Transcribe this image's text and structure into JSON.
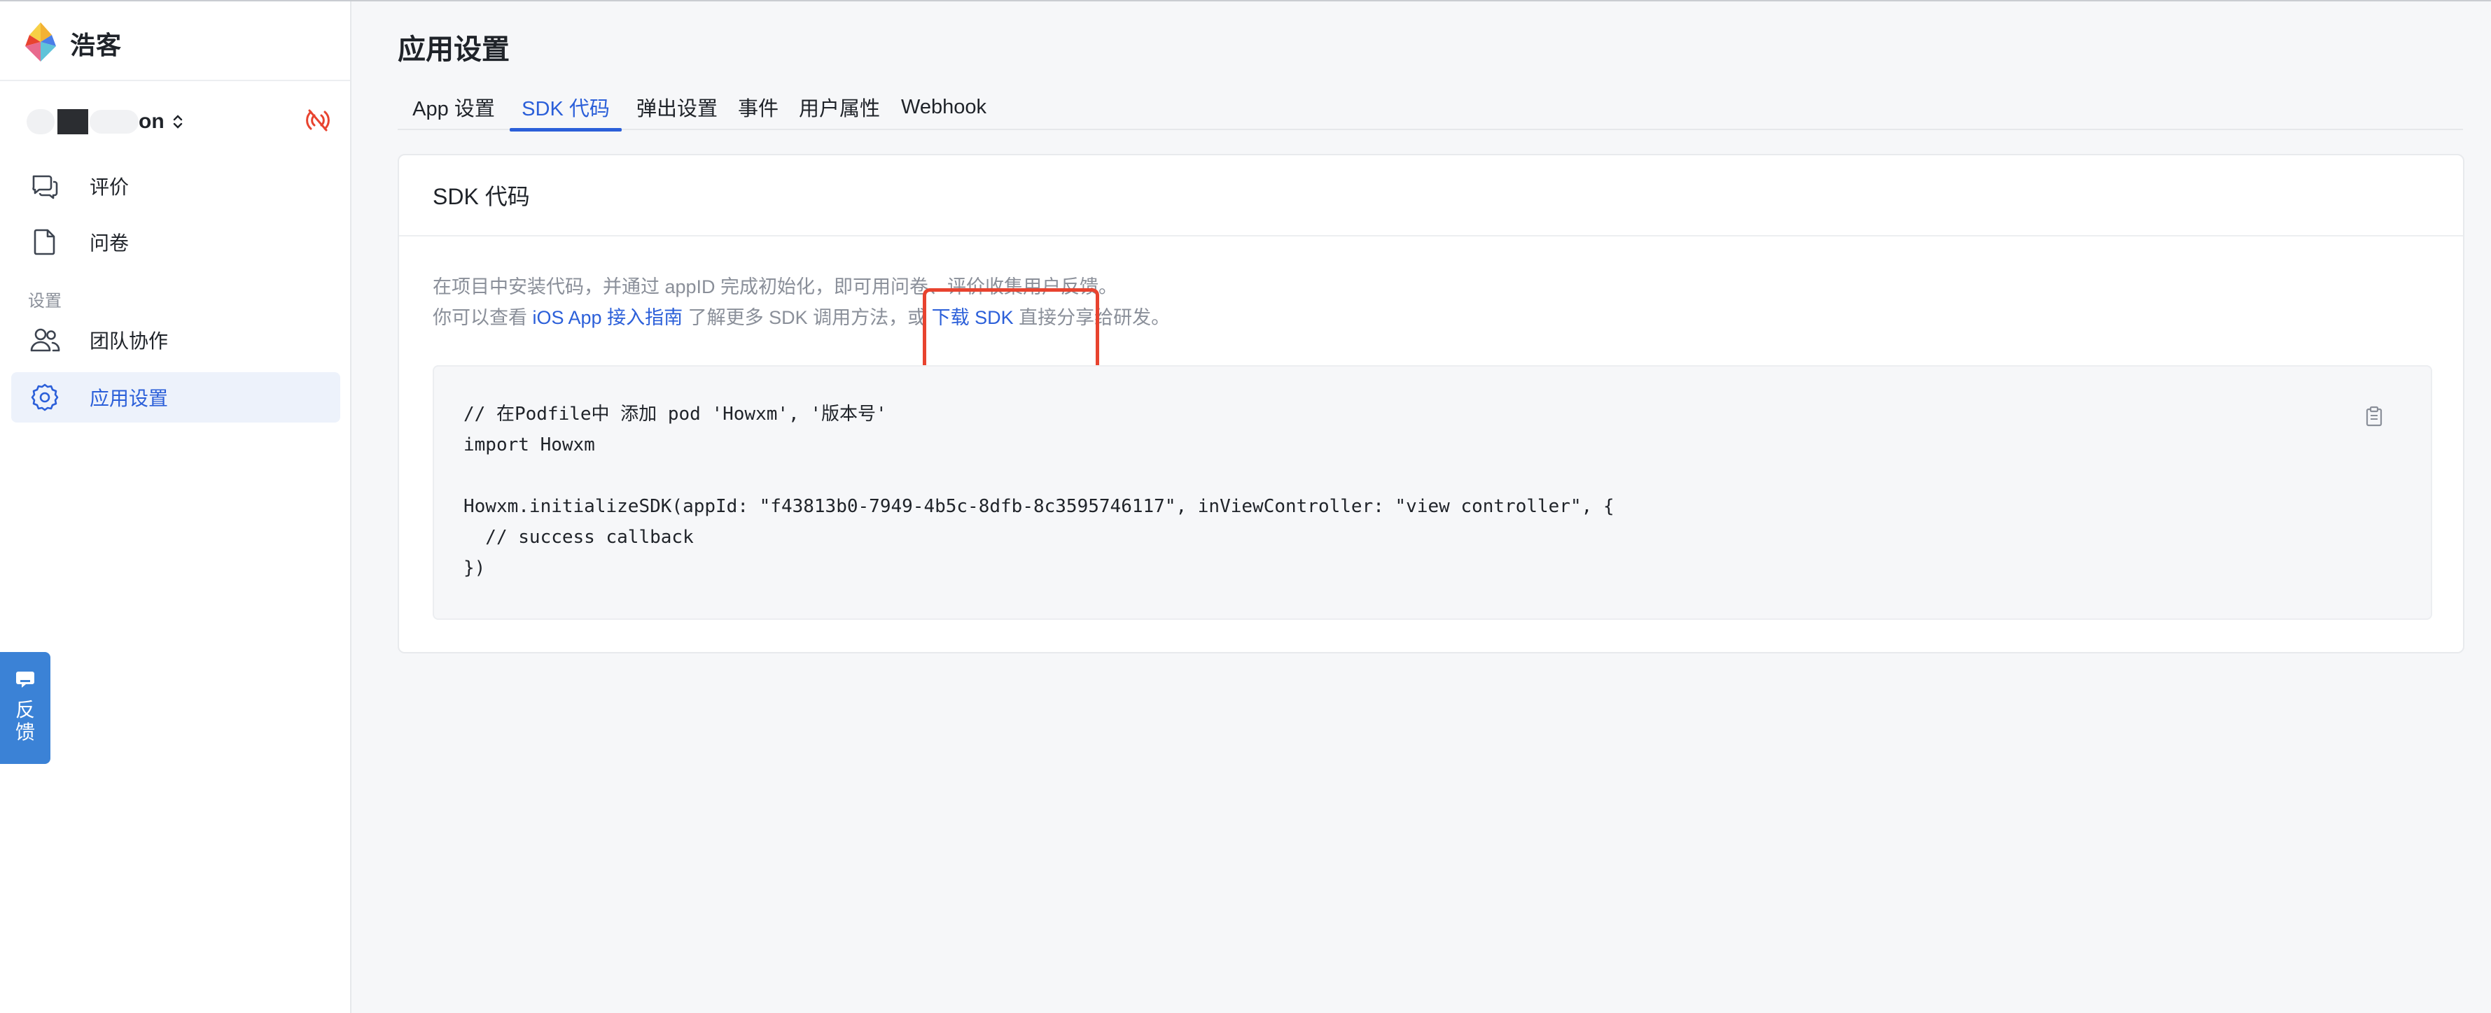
{
  "brand": {
    "name": "浩客",
    "logo_icon": "howxm-logo-icon"
  },
  "project": {
    "name_suffix": "on",
    "switch_icon": "updown-chevron-icon",
    "status_icon": "signal-off-icon",
    "status_color": "#e8432f"
  },
  "sidebar": {
    "items": [
      {
        "label": "评价",
        "icon": "chat-bubbles-icon"
      },
      {
        "label": "问卷",
        "icon": "document-icon"
      }
    ],
    "section_label": "设置",
    "settings_items": [
      {
        "label": "团队协作",
        "icon": "users-icon"
      },
      {
        "label": "应用设置",
        "icon": "gear-icon",
        "active": true
      }
    ]
  },
  "feedback_float": {
    "label": "反馈",
    "icon": "message-icon"
  },
  "page": {
    "title": "应用设置"
  },
  "tabs": [
    {
      "label": "App 设置"
    },
    {
      "label": "SDK 代码",
      "active": true
    },
    {
      "label": "弹出设置"
    },
    {
      "label": "事件"
    },
    {
      "label": "用户属性"
    },
    {
      "label": "Webhook"
    }
  ],
  "card": {
    "title": "SDK 代码",
    "desc_line1": "在项目中安装代码，并通过 appID 完成初始化，即可用问卷、评价收集用户反馈。",
    "desc_line2_prefix": "你可以查看 ",
    "desc_link_guide": "iOS App 接入指南",
    "desc_line2_mid": " 了解更多 SDK 调用方法，或 ",
    "desc_link_download": "下载 SDK",
    "desc_line2_suffix": " 直接分享给研发。"
  },
  "code": {
    "lines": [
      "// 在Podfile中 添加 pod 'Howxm', '版本号'",
      "import Howxm",
      "",
      "Howxm.initializeSDK(appId: \"f43813b0-7949-4b5c-8dfb-8c3595746117\", inViewController: \"view controller\", {",
      "  // success callback",
      "})"
    ],
    "copy_icon": "clipboard-icon"
  },
  "colors": {
    "accent": "#2b5fd9",
    "highlight": "#e8432f",
    "feedback_bg": "#3b82d6"
  }
}
